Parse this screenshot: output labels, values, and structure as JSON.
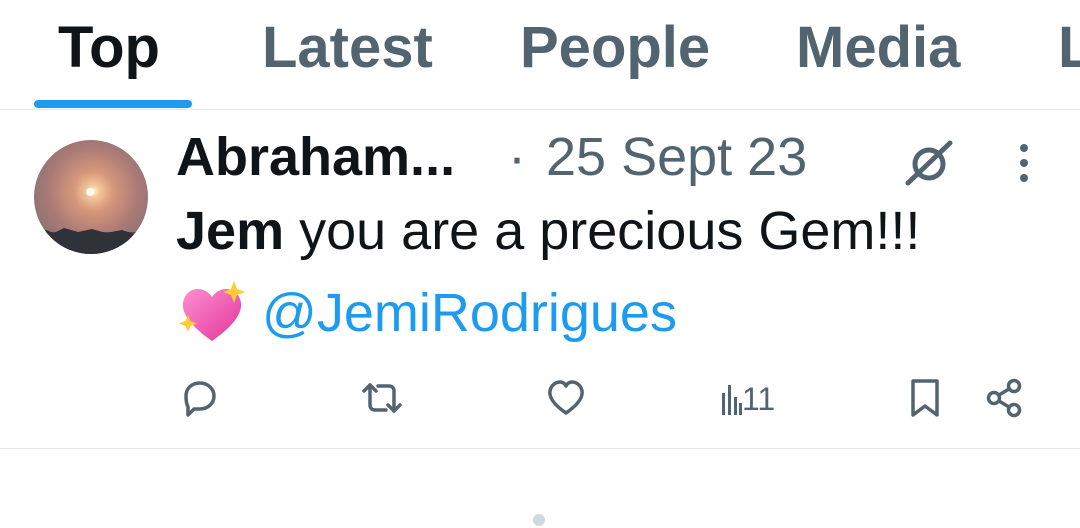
{
  "tabs": [
    {
      "label": "Top",
      "active": true
    },
    {
      "label": "Latest",
      "active": false
    },
    {
      "label": "People",
      "active": false
    },
    {
      "label": "Media",
      "active": false
    },
    {
      "label": "L",
      "active": false
    }
  ],
  "accent_color": "#1d9bf0",
  "tweet": {
    "author_name": "Abraham...",
    "separator": "·",
    "date": "25 Sept 23",
    "text_bold": "Jem",
    "text_rest": " you are a precious Gem!!!",
    "emoji": "sparkling-heart",
    "mention": "@JemiRodrigues",
    "actions": {
      "reply_icon": "reply-icon",
      "retweet_icon": "retweet-icon",
      "like_icon": "heart-icon",
      "views_icon": "views-icon",
      "views_count": "11",
      "bookmark_icon": "bookmark-icon",
      "share_icon": "share-icon"
    }
  }
}
